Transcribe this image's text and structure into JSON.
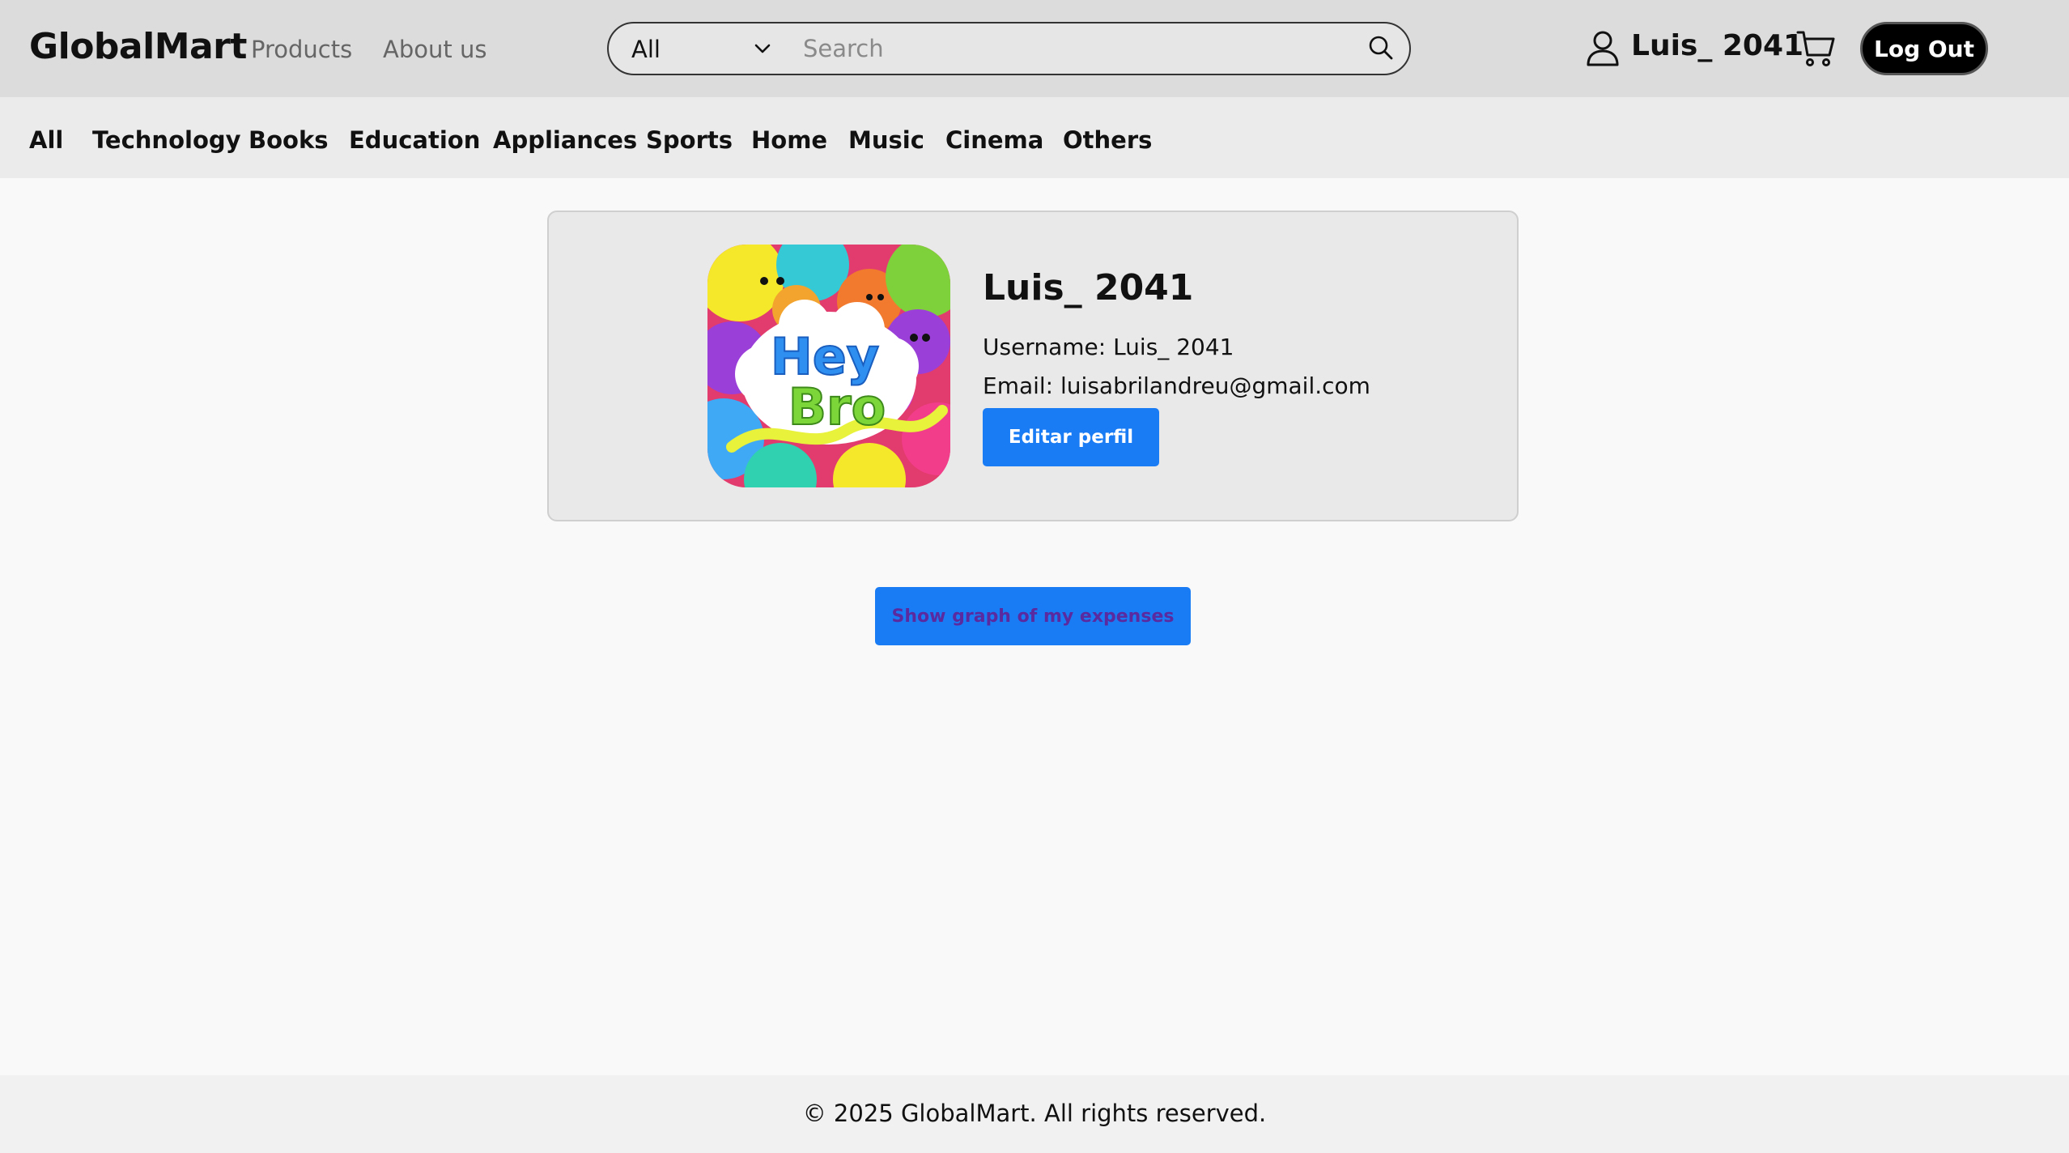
{
  "header": {
    "brand": "GlobalMart",
    "nav": [
      "Products",
      "About us"
    ],
    "search": {
      "category_value": "All",
      "placeholder": "Search",
      "value": ""
    },
    "user": {
      "name": "Luis_ 2041"
    },
    "logout_label": "Log Out"
  },
  "categories": [
    "All",
    "Technology",
    "Books",
    "Education",
    "Appliances",
    "Sports",
    "Home",
    "Music",
    "Cinema",
    "Others"
  ],
  "profile": {
    "display_name": "Luis_ 2041",
    "username_line": "Username: Luis_ 2041",
    "email_line": "Email: luisabrilandreu@gmail.com",
    "edit_label": "Editar perfil",
    "avatar_text": [
      "Hey",
      "Bro"
    ]
  },
  "graph_button_label": "Show graph of my expenses",
  "footer": {
    "text": "© 2025 GlobalMart. All rights reserved."
  },
  "colors": {
    "header_bg": "#dcdcdc",
    "category_bg": "#ebebeb",
    "primary_button": "#1a7cf5",
    "logout_bg": "#000000",
    "page_bg": "#f9f9f9"
  },
  "icons": [
    "chevron-down-icon",
    "search-icon",
    "user-icon",
    "cart-icon"
  ]
}
